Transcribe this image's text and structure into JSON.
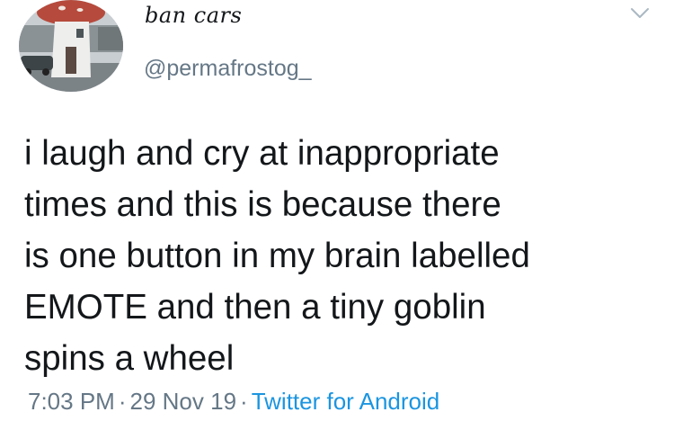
{
  "tweet": {
    "display_name": "ban cars",
    "handle": "@permafrostog_",
    "text": "i laugh and cry at inappropriate\ntimes and this is because there\nis one button in my brain labelled\nEMOTE and then a tiny goblin\nspins a wheel",
    "time": "7:03 PM",
    "separator": "·",
    "date": "29 Nov 19",
    "source": "Twitter for Android",
    "avatar_icon": "mushroom-house-avatar",
    "menu_icon": "chevron-down-icon",
    "colors": {
      "text": "#14171a",
      "secondary": "#657786",
      "link": "#1b95e0"
    }
  }
}
